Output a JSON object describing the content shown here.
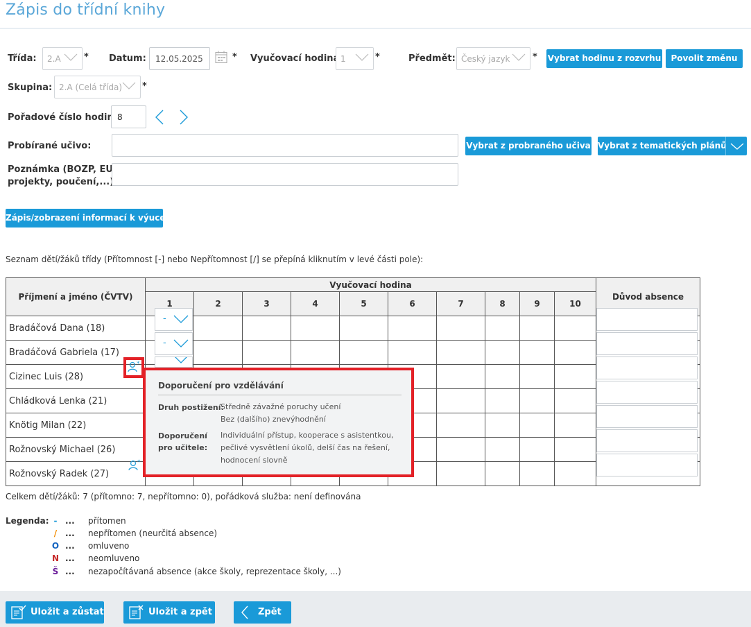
{
  "page": {
    "title": "Zápis do třídní knihy"
  },
  "form": {
    "trida": {
      "label": "Třída:",
      "value": "2.A",
      "required": "*"
    },
    "datum": {
      "label": "Datum:",
      "value": "12.05.2025",
      "required": "*"
    },
    "hodina": {
      "label": "Vyučovací hodina:",
      "value": "1",
      "required": "*"
    },
    "predmet": {
      "label": "Předmět:",
      "value": "Český jazyk",
      "required": "*"
    },
    "skupina": {
      "label": "Skupina:",
      "value": "2.A (Celá třída)",
      "required": "*"
    },
    "poradove": {
      "label": "Pořadové číslo hodiny:",
      "value": "8"
    },
    "ucivo": {
      "label": "Probírané učivo:",
      "value": ""
    },
    "poznamka": {
      "label_line1": "Poznámka (BOZP, EU",
      "label_line2": "projekty, poučení,...):",
      "value": ""
    }
  },
  "buttons": {
    "vybrat_hodinu": "Vybrat hodinu z rozvrhu",
    "povolit_zmenu": "Povolit změnu",
    "vybrat_ucivo": "Vybrat z probraného učiva",
    "vybrat_plany": "Vybrat z tematických plánů",
    "zapis_info": "Zápis/zobrazení informací k výuce"
  },
  "list_intro": "Seznam dětí/žáků třídy (Přítomnost [-] nebo Nepřítomnost [/] se přepíná kliknutím v levé části pole):",
  "table": {
    "col_name": "Příjmení a jméno (ČVTV)",
    "col_hours": "Vyučovací hodina",
    "col_reason": "Důvod absence",
    "hours": [
      "1",
      "2",
      "3",
      "4",
      "5",
      "6",
      "7",
      "8",
      "9",
      "10"
    ],
    "students": [
      {
        "name": "Bradáčová Dana (18)",
        "status": "-"
      },
      {
        "name": "Bradáčová Gabriela (17)",
        "status": "-"
      },
      {
        "name": "Cizinec Luis (28)",
        "status": "-"
      },
      {
        "name": "Chládková Lenka (21)",
        "status": "-"
      },
      {
        "name": "Knötig Milan (22)",
        "status": "-"
      },
      {
        "name": "Rožnovský Michael (26)",
        "status": "-"
      },
      {
        "name": "Rožnovský Radek (27)",
        "status": "-"
      }
    ]
  },
  "tooltip": {
    "title": "Doporučení pro vzdělávání",
    "druh_label": "Druh postižení:",
    "druh_values": [
      "Středně závažné poruchy učení",
      "Bez (dalšího) znevýhodnění"
    ],
    "doporuceni_label_1": "Doporučení",
    "doporuceni_label_2": "pro učitele:",
    "doporuceni_values": [
      "Individuální přístup, kooperace s asistentkou,",
      "pečlivé vysvětlení úkolů, delší čas na řešení,",
      "hodnocení slovně"
    ]
  },
  "summary": "Celkem dětí/žáků: 7 (přítomno: 7, nepřítomno: 0), pořádková služba: není definována",
  "legend": {
    "label": "Legenda:",
    "dots": "...",
    "items": [
      {
        "symbol": "-",
        "text": "přítomen",
        "color": "#1a9ad8"
      },
      {
        "symbol": "/",
        "text": "nepřítomen (neurčitá absence)",
        "color": "#f28c00"
      },
      {
        "symbol": "O",
        "text": "omluveno",
        "color": "#1565c0"
      },
      {
        "symbol": "N",
        "text": "neomluveno",
        "color": "#c62828"
      },
      {
        "symbol": "Š",
        "text": "nezapočítávaná absence (akce školy, reprezentace školy, ...)",
        "color": "#6a1b9a"
      }
    ]
  },
  "footer": {
    "ulozit_zustat": "Uložit a zůstat",
    "ulozit_zpet": "Uložit a zpět",
    "zpet": "Zpět"
  },
  "colors": {
    "accent": "#1a9ad8",
    "highlight": "#e32127",
    "title": "#5aa7d8"
  }
}
